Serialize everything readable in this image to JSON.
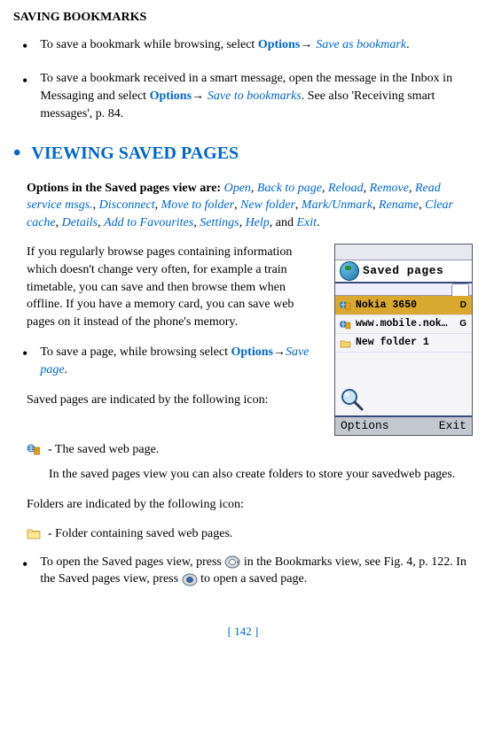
{
  "heading_saving": "SAVING BOOKMARKS",
  "bullets_top": [
    {
      "pre": "To save a bookmark while browsing, select ",
      "opt": "Options",
      "arr": "→ ",
      "ital": "Save as bookmark",
      "post": "."
    },
    {
      "pre": "To save a bookmark received in a smart message, open the message in the Inbox in Messaging and select ",
      "opt": "Options",
      "arr": "→ ",
      "ital": "Save to bookmarks",
      "post": ". See also 'Receiving smart messages', p. 84."
    }
  ],
  "section_title": "VIEWING SAVED PAGES",
  "options": {
    "lead": "Options in the Saved pages view are: ",
    "items": [
      "Open",
      "Back to page",
      "Reload",
      "Remove",
      "Read service msgs.",
      "Disconnect",
      "Move to folder",
      "New folder",
      "Mark/Unmark",
      "Rename",
      "Clear cache",
      "Details",
      "Add to Favourites",
      "Settings",
      "Help"
    ],
    "and": ", and ",
    "last": "Exit",
    "end": "."
  },
  "para1": "If you regularly browse pages containing information which doesn't change very often, for example a train timetable, you can save and then browse them when offline. If you have a memory card, you can save web pages on it instead of the phone's memory.",
  "bullet_save": {
    "pre": "To save a page, while browsing select ",
    "opt": "Options",
    "arr": "→",
    "ital": "Save page",
    "post": "."
  },
  "para_saved": "Saved pages are indicated by the following icon:",
  "icon_saved": " - The saved web page.",
  "indent1": "In the saved pages view you can also create folders to store your savedweb pages.",
  "para_folder": "Folders are indicated by the following icon:",
  "icon_folder": " - Folder containing saved web pages.",
  "bullet_open": {
    "pre": "To open the Saved pages view, press ",
    "mid": " in the Bookmarks view, see Fig. 4, p. 122. In the Saved pages view, press ",
    "post": " to open a saved page."
  },
  "footer": "[ 142 ]",
  "screenshot": {
    "title": "Saved pages",
    "rows": [
      {
        "label": "Nokia 3650",
        "end": "D"
      },
      {
        "label": "www.mobile.nok…",
        "end": "G"
      },
      {
        "label": "New folder 1",
        "end": ""
      }
    ],
    "sk_left": "Options",
    "sk_right": "Exit"
  }
}
